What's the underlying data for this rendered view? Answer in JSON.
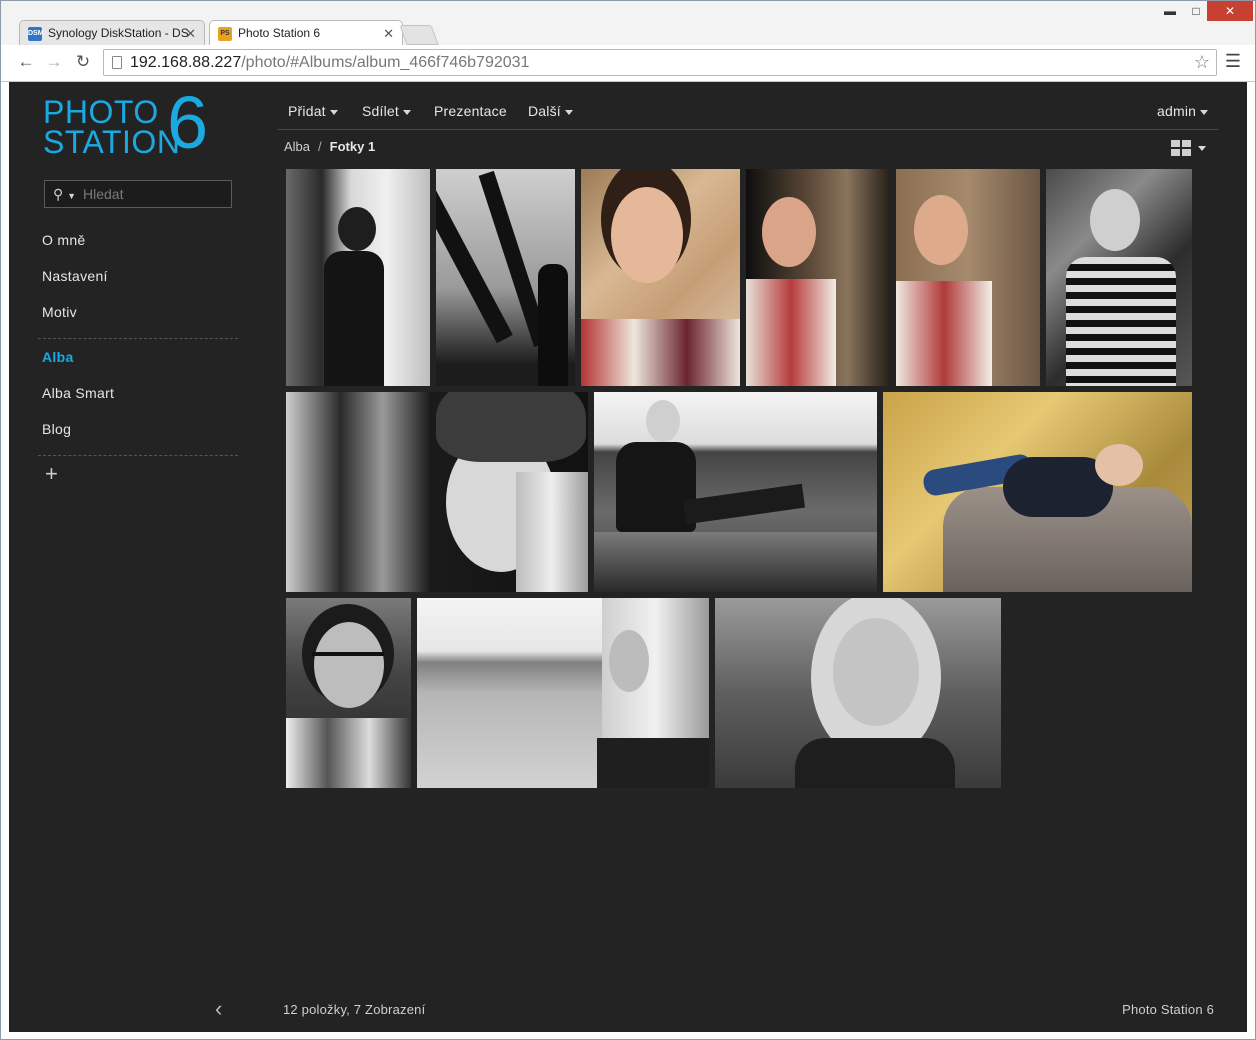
{
  "browser": {
    "tabs": [
      {
        "title": "Synology DiskStation - DS",
        "favicon": "DSM"
      },
      {
        "title": "Photo Station 6",
        "favicon": "PS"
      }
    ],
    "controls": {
      "minimize": "▬",
      "maximize": "□",
      "close": "✕"
    },
    "url_host": "192.168.88.227",
    "url_path": "/photo/#Albums/album_466f746b792031"
  },
  "logo": {
    "line1": "PHOTO",
    "line2": "STATION",
    "number": "6"
  },
  "search": {
    "placeholder": "Hledat"
  },
  "sidebar": {
    "items": [
      {
        "label": "O mně"
      },
      {
        "label": "Nastavení"
      },
      {
        "label": "Motiv"
      },
      {
        "label": "Alba",
        "active": true
      },
      {
        "label": "Alba Smart"
      },
      {
        "label": "Blog"
      }
    ],
    "add_label": "+"
  },
  "topmenu": {
    "add": "Přidat",
    "share": "Sdílet",
    "slideshow": "Prezentace",
    "more": "Další",
    "user": "admin"
  },
  "breadcrumb": {
    "root": "Alba",
    "separator": "/",
    "current": "Fotky 1"
  },
  "photos": [
    {
      "tone": "bw",
      "subject": "woman-by-tree"
    },
    {
      "tone": "bw",
      "subject": "steel-structure"
    },
    {
      "tone": "color",
      "subject": "portrait-hand"
    },
    {
      "tone": "color",
      "subject": "profile-tree"
    },
    {
      "tone": "color",
      "subject": "profile-tree-2"
    },
    {
      "tone": "bw",
      "subject": "leather-jacket"
    },
    {
      "tone": "bw",
      "subject": "beanie-closeup"
    },
    {
      "tone": "bw",
      "subject": "sitting-by-water"
    },
    {
      "tone": "color",
      "subject": "lying-on-rock"
    },
    {
      "tone": "bw",
      "subject": "glasses-portrait"
    },
    {
      "tone": "bw",
      "subject": "lake-profile"
    },
    {
      "tone": "bw",
      "subject": "smiling-portrait"
    }
  ],
  "footer": {
    "stats": "12 položky, 7 Zobrazení",
    "brand": "Photo Station 6"
  },
  "colors": {
    "accent": "#1ba9e1",
    "background": "#232323"
  }
}
